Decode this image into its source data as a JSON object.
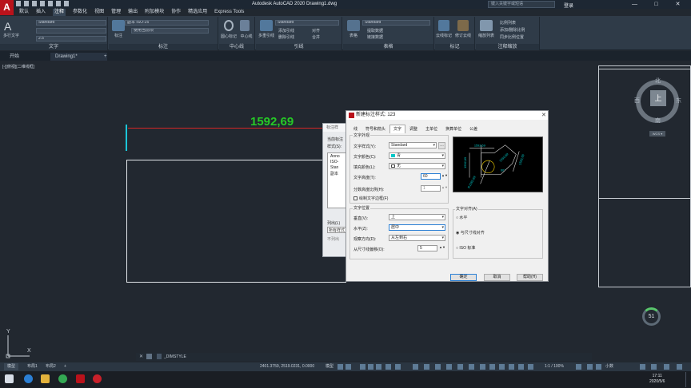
{
  "app": {
    "title": "Autodesk AutoCAD 2020    Drawing1.dwg",
    "logo": "A",
    "signin": "登录",
    "search_placeholder": "键入关键字或短语",
    "window_controls": [
      "—",
      "□",
      "✕"
    ]
  },
  "menu": {
    "items": [
      "默认",
      "插入",
      "注释",
      "参数化",
      "视图",
      "管理",
      "输出",
      "附加模块",
      "协作",
      "精选应用",
      "Express Tools"
    ],
    "active_index": 2
  },
  "ribbon": {
    "text_panel": {
      "title": "文字",
      "big_label": "多行文字",
      "style_combo": "Standard",
      "font_combo": "",
      "height_combo": "2.5"
    },
    "dim_panel": {
      "title": "标注",
      "big_label": "标注",
      "style_combo": "副本 ISO-25",
      "layer_combo": "使用当前项"
    },
    "centerline_panel": {
      "title": "中心线",
      "labels": [
        "圆心标记",
        "中心线"
      ]
    },
    "leader_panel": {
      "title": "引线",
      "big_label": "多重引线",
      "style_combo": "Standard",
      "labels": [
        "添加引线",
        "删除引线",
        "对齐",
        "合并"
      ]
    },
    "table_panel": {
      "title": "表格",
      "big_label": "表格",
      "style_combo": "Standard",
      "labels": [
        "提取数据",
        "链接数据"
      ]
    },
    "markup_panel": {
      "title": "标记",
      "labels": [
        "云线标记",
        "修订云线"
      ]
    },
    "annoscale_panel": {
      "title": "注释缩放",
      "big_label": "缩放列表",
      "labels": [
        "比例列表",
        "添加/删除比例",
        "同步比例位置"
      ]
    }
  },
  "doc_tabs": {
    "start": "开始",
    "drawing": "Drawing1*",
    "add": "+"
  },
  "canvas": {
    "view_label": "[-][俯视][二维线框]",
    "dimension_text": "1592,69",
    "viewcube": {
      "top": "上",
      "north": "北",
      "south": "南",
      "east": "东",
      "west": "西",
      "wcs": "WCS ▾"
    },
    "zoom_percent": "51",
    "ucs": {
      "x": "X",
      "y": "Y"
    }
  },
  "bg_dialog": {
    "title": "标注样",
    "lines": [
      "当前标注",
      "样式(S):",
      "Anno",
      "ISO-",
      "Stan",
      "副本",
      "列出(L)",
      "所有样式",
      "不列出"
    ]
  },
  "dialog": {
    "title": "新建标注样式: 123",
    "close": "✕",
    "tabs": [
      "线",
      "符号和箭头",
      "文字",
      "调整",
      "主单位",
      "换算单位",
      "公差"
    ],
    "active_tab": 2,
    "appearance": {
      "group_title": "文字外观",
      "style_label": "文字样式(Y):",
      "style_value": "Standard",
      "color_label": "文字颜色(C):",
      "color_value": "青",
      "color_hex": "#00c8c8",
      "fill_label": "填充颜色(L):",
      "fill_value": "无",
      "height_label": "文字高度(T):",
      "height_value": "60",
      "fraction_label": "分数高度比例(H):",
      "fraction_value": "1",
      "frame_label": "绘制文字边框(F)"
    },
    "placement": {
      "group_title": "文字位置",
      "vertical_label": "垂直(V):",
      "vertical_value": "上",
      "horizontal_label": "水平(Z):",
      "horizontal_value": "居中",
      "view_dir_label": "观察方向(D):",
      "view_dir_value": "从左到右",
      "offset_label": "从尺寸线偏移(O):",
      "offset_value": "5"
    },
    "alignment": {
      "group_title": "文字对齐(A)",
      "options": [
        "水平",
        "与尺寸线对齐",
        "ISO 标准"
      ],
      "selected_index": 1
    },
    "preview": {
      "dims": [
        "1592,69",
        "1592,69",
        "1592,69",
        "1592,69",
        "R1592,69",
        "60°"
      ]
    },
    "buttons": {
      "ok": "确定",
      "cancel": "取消",
      "help": "帮助(H)"
    }
  },
  "command": {
    "prompt": "_DIMSTYLE",
    "close": "✕",
    "wrench": "🔧"
  },
  "layout_tabs": [
    "模型",
    "布局1",
    "布局2",
    "+"
  ],
  "statusbar": {
    "coords": "2401.3759, 2519.0231, 0.0000",
    "model": "模型",
    "scale": "1:1 / 100%",
    "units": "小数"
  },
  "taskbar": {
    "time": "17:11",
    "date": "2020/5/6"
  }
}
